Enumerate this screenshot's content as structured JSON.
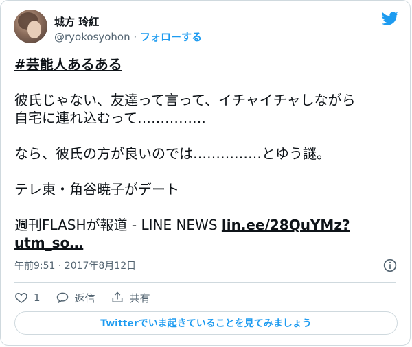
{
  "author": {
    "name": "城方 玲紅",
    "handle": "@ryokosyohon",
    "separator": "·",
    "follow_label": "フォローする"
  },
  "tweet": {
    "hashtag": "#芸能人あるある",
    "line1": "彼氏じゃない、友達って言って、イチャイチャしながら",
    "line2": "自宅に連れ込むって……………",
    "line3": "なら、彼氏の方が良いのでは……………とゆう謎。",
    "line4": "テレ東・角谷暁子がデート",
    "line5_prefix": "週刊FLASHが報道  - LINE NEWS ",
    "link_part1": "lin.ee/28QuYMz?",
    "link_part2": "utm_so…"
  },
  "meta": {
    "timestamp": "午前9:51 · 2017年8月12日"
  },
  "actions": {
    "like_count": "1",
    "reply_label": "返信",
    "share_label": "共有"
  },
  "cta": {
    "label": "Twitterでいま起きていることを見てみましょう"
  },
  "colors": {
    "brand": "#1d9bf0",
    "text": "#0f1419",
    "muted": "#536471",
    "border": "#cfd9de"
  },
  "icons": [
    "twitter-bird-icon",
    "info-icon",
    "heart-icon",
    "reply-icon",
    "share-icon"
  ]
}
